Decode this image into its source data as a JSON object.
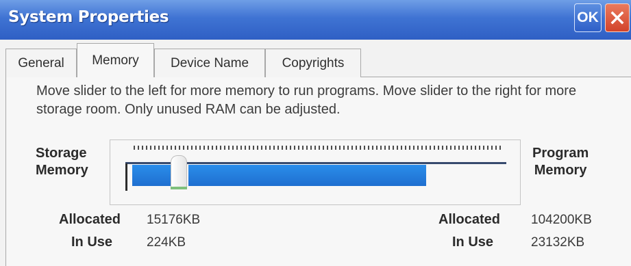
{
  "window": {
    "title": "System Properties",
    "ok_label": "OK",
    "close_icon": "close-icon"
  },
  "tabs": [
    {
      "label": "General",
      "active": false
    },
    {
      "label": "Memory",
      "active": true
    },
    {
      "label": "Device Name",
      "active": false
    },
    {
      "label": "Copyrights",
      "active": false
    }
  ],
  "memory": {
    "description": "Move slider to the left for more memory to run programs. Move slider to the right for more storage room. Only unused RAM can be adjusted.",
    "storage_label_line1": "Storage",
    "storage_label_line2": "Memory",
    "program_label_line1": "Program",
    "program_label_line2": "Memory",
    "slider_fraction": 0.13,
    "storage": {
      "allocated_label": "Allocated",
      "allocated_value": "15176KB",
      "in_use_label": "In Use",
      "in_use_value": "224KB"
    },
    "program": {
      "allocated_label": "Allocated",
      "allocated_value": "104200KB",
      "in_use_label": "In Use",
      "in_use_value": "23132KB"
    }
  },
  "colors": {
    "titlebar": "#3f73d3",
    "slider_fill": "#1f6fd0",
    "close_button": "#d2432a"
  }
}
